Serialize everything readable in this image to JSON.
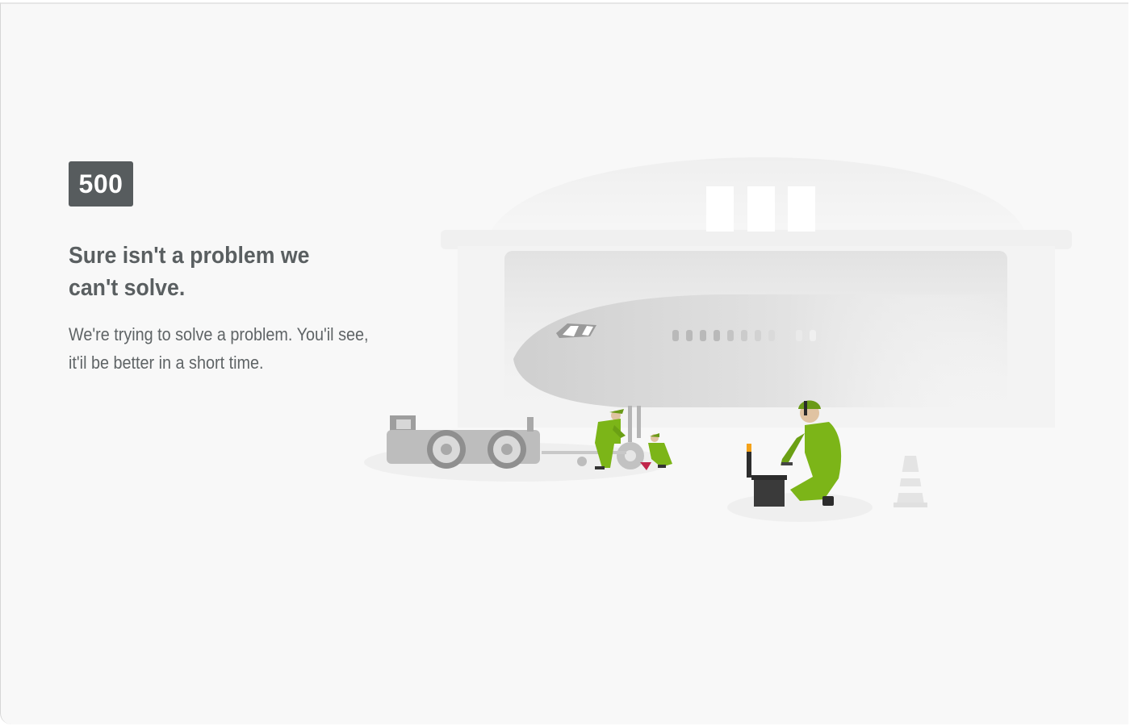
{
  "error": {
    "code": "500",
    "headline": "Sure isn't a problem we can't solve.",
    "message": "We're trying to solve a problem. You'il see, it'il be better in a short time."
  },
  "illustration": {
    "subject": "hangar-airplane-maintenance",
    "worker_color": "#7cb518",
    "tug_color": "#bdbdbd"
  }
}
